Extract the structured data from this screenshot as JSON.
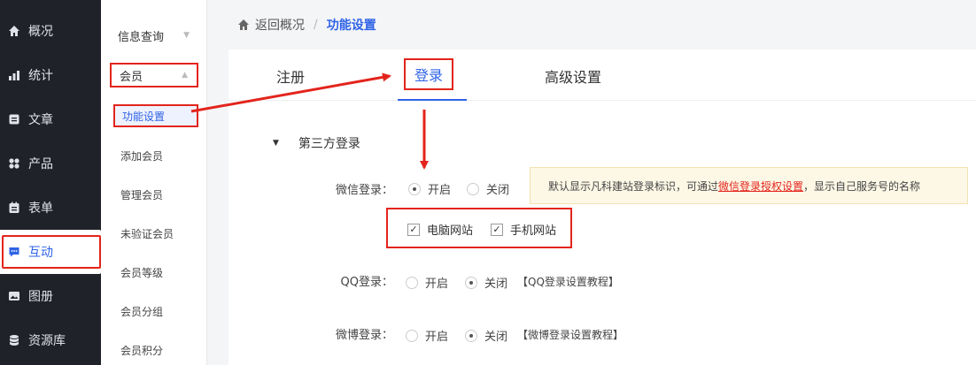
{
  "nav": {
    "items": [
      {
        "label": "概况",
        "icon": "home-icon"
      },
      {
        "label": "统计",
        "icon": "stats-icon"
      },
      {
        "label": "文章",
        "icon": "article-icon"
      },
      {
        "label": "产品",
        "icon": "product-icon"
      },
      {
        "label": "表单",
        "icon": "form-icon"
      },
      {
        "label": "互动",
        "icon": "chat-icon"
      },
      {
        "label": "图册",
        "icon": "album-icon"
      },
      {
        "label": "资源库",
        "icon": "database-icon"
      }
    ],
    "active_index": 5
  },
  "subnav": {
    "groups": [
      {
        "label": "信息查询"
      },
      {
        "label": "会员"
      }
    ],
    "items": [
      "功能设置",
      "添加会员",
      "管理会员",
      "未验证会员",
      "会员等级",
      "会员分组",
      "会员积分"
    ]
  },
  "breadcrumb": {
    "back": "返回概况",
    "separator": "/",
    "current": "功能设置"
  },
  "tabs": [
    "注册",
    "登录",
    "高级设置"
  ],
  "section": {
    "title": "第三方登录"
  },
  "wechat": {
    "label": "微信登录：",
    "on": "开启",
    "off": "关闭",
    "selected": "开启",
    "tip_prefix": "默认显示凡科建站登录标识，可通过",
    "tip_link": "微信登录授权设置",
    "tip_suffix": "，显示自己服务号的名称",
    "options": [
      "电脑网站",
      "手机网站"
    ]
  },
  "qq": {
    "label": "QQ登录：",
    "on": "开启",
    "off": "关闭",
    "selected": "关闭",
    "tutorial": "【QQ登录设置教程】"
  },
  "weibo": {
    "label": "微博登录：",
    "on": "开启",
    "off": "关闭",
    "selected": "关闭",
    "tutorial": "【微博登录设置教程】"
  },
  "colors": {
    "nav_bg": "#1f2329",
    "accent": "#2f63e6",
    "annotation": "#e3241c",
    "tip_bg": "#fdf8e6"
  }
}
